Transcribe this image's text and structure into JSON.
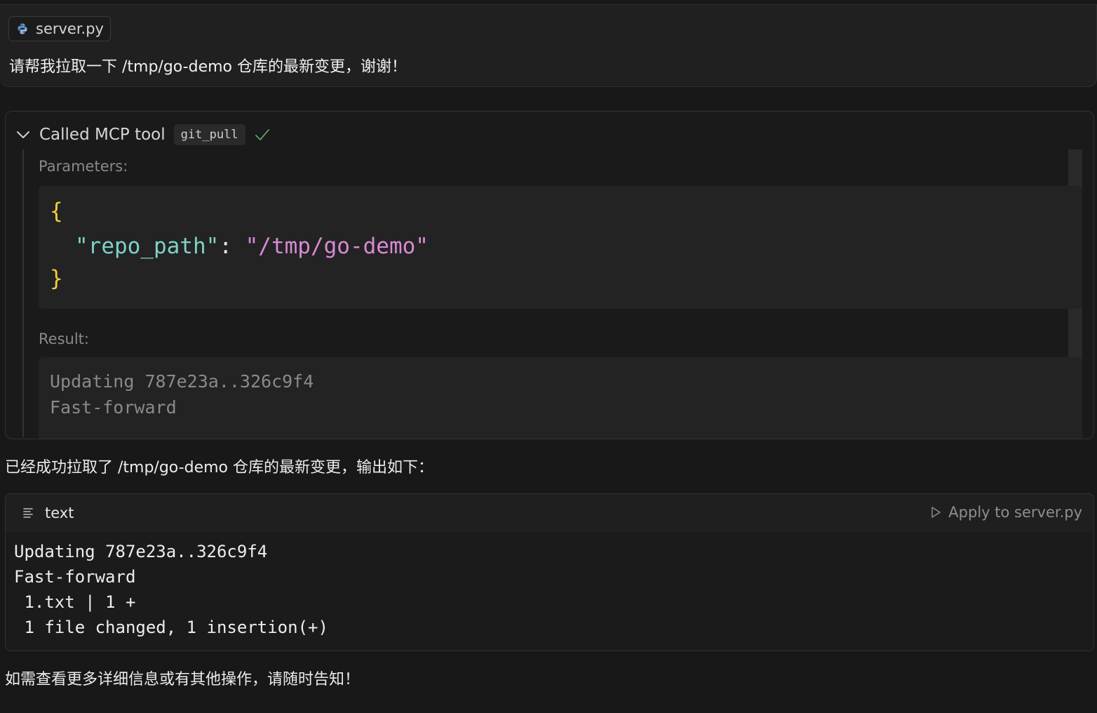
{
  "user_message": {
    "file_chip": {
      "name": "server.py",
      "icon": "python-icon"
    },
    "text": "请帮我拉取一下 /tmp/go-demo 仓库的最新变更，谢谢！"
  },
  "tool_call": {
    "title": "Called MCP tool",
    "tool_name": "git_pull",
    "status_icon": "check-icon",
    "status_color": "#5aa469",
    "parameters_label": "Parameters:",
    "parameters": {
      "open_brace": "{",
      "key": "\"repo_path\"",
      "colon": ": ",
      "value": "\"/tmp/go-demo\"",
      "close_brace": "}"
    },
    "result_label": "Result:",
    "result_lines": [
      "Updating 787e23a..326c9f4",
      "Fast-forward"
    ]
  },
  "assistant": {
    "intro": "已经成功拉取了 /tmp/go-demo 仓库的最新变更，输出如下：",
    "code_block": {
      "language": "text",
      "apply_label": "Apply to server.py",
      "lines": [
        "Updating 787e23a..326c9f4",
        "Fast-forward",
        " 1.txt | 1 +",
        " 1 file changed, 1 insertion(+)"
      ]
    },
    "outro": "如需查看更多详细信息或有其他操作，请随时告知！"
  },
  "colors": {
    "background": "#181818",
    "json_brace": "#f2cc3a",
    "json_key": "#7fd1c7",
    "json_string": "#d88ad5"
  }
}
